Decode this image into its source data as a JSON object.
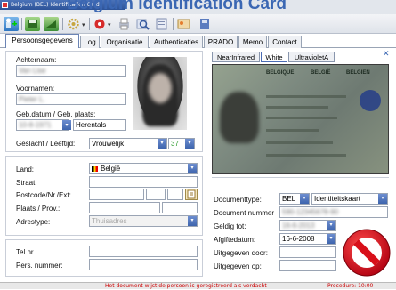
{
  "window": {
    "title": "Belgium (BEL) Identification Card",
    "banner": "Belgium Identification Card"
  },
  "toolbar": {
    "icons": [
      "user-add-icon",
      "save-icon",
      "import-icon",
      "settings-icon",
      "record-icon",
      "print-icon",
      "search-icon",
      "scan-icon",
      "photo-icon",
      "export-icon"
    ]
  },
  "tabs": [
    "Persoonsgegevens",
    "Log",
    "Organisatie",
    "Authenticaties",
    "PRADO",
    "Memo",
    "Contact"
  ],
  "person": {
    "achternaam_label": "Achternaam:",
    "achternaam_value": "Van Lise",
    "voornamen_label": "Voornamen:",
    "voornamen_value": "Pieter L.",
    "geb_label": "Geb.datum / Geb. plaats:",
    "geb_datum": "10-8-1971",
    "geb_plaats": "Herentals",
    "geslacht_label": "Geslacht / Leeftijd:",
    "geslacht_value": "Vrouwelijk",
    "leeftijd_value": "37"
  },
  "address": {
    "land_label": "Land:",
    "land_value": "België",
    "straat_label": "Straat:",
    "postcode_label": "Postcode/Nr./Ext:",
    "plaats_label": "Plaats / Prov.:",
    "adrestype_label": "Adrestype:",
    "adrestype_value": "Thuisadres"
  },
  "contact": {
    "tel_label": "Tel.nr",
    "pers_label": "Pers. nummer:"
  },
  "image_tabs": [
    "NearInfrared",
    "White",
    "UltravioletA"
  ],
  "card": {
    "country": "BELGIQUE",
    "country2": "BELGIË",
    "country3": "BELGIEN"
  },
  "document": {
    "type_label": "Documenttype:",
    "type_country": "BEL",
    "type_value": "Identiteitskaart",
    "nummer_label": "Document nummer",
    "nummer_value": "590-12345678-90",
    "geldig_label": "Geldig tot:",
    "geldig_value": "16-6-2013",
    "afgifte_label": "Afgiftedatum:",
    "afgifte_value": "16-6-2008",
    "uitg_door_label": "Uitgegeven door:",
    "uitg_op_label": "Uitgegeven op:"
  },
  "status": {
    "left": "Het document wijst de persoon is geregistreerd als verdacht",
    "right": "Procedure: 10:00"
  },
  "colors": {
    "accent": "#3b67b3",
    "tab_active_border": "#6b84b5",
    "stop_red": "#d8101a",
    "dropdown_blue": "#3e64ad"
  }
}
